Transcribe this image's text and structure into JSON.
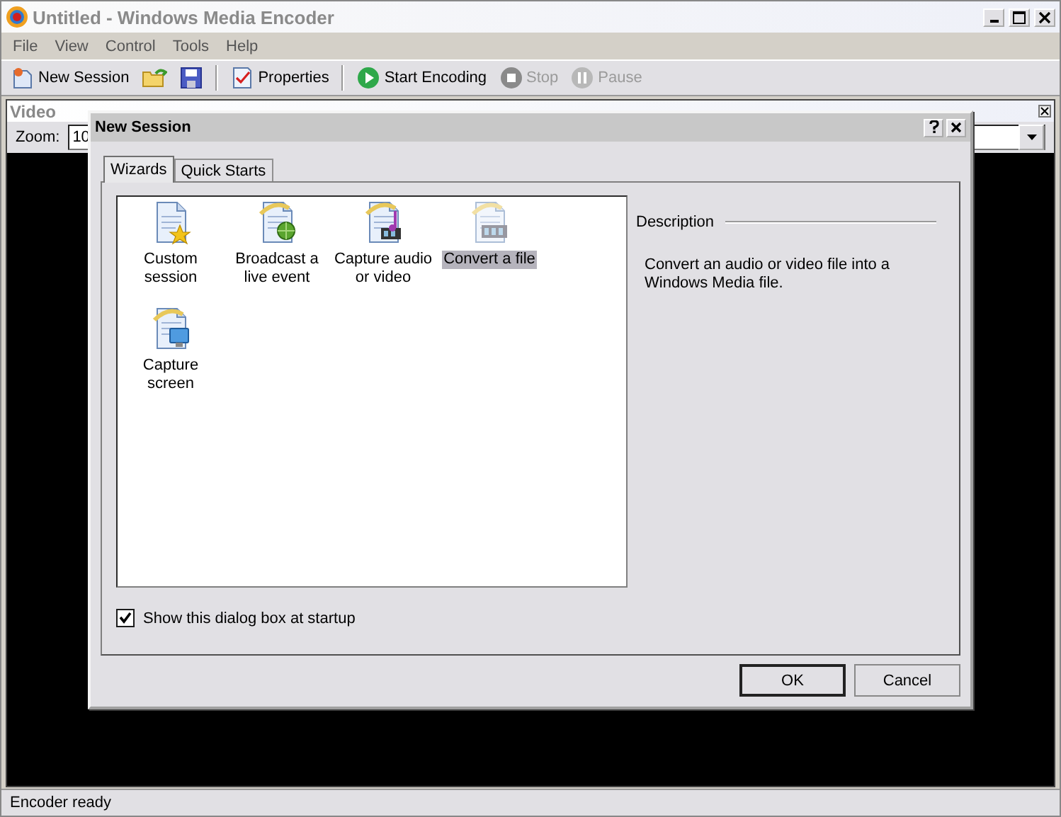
{
  "window": {
    "title": "Untitled - Windows Media Encoder"
  },
  "menu": [
    "File",
    "View",
    "Control",
    "Tools",
    "Help"
  ],
  "toolbar": [
    {
      "kind": "new",
      "label": "New Session",
      "disabled": false
    },
    {
      "kind": "open"
    },
    {
      "kind": "save"
    },
    {
      "kind": "separator"
    },
    {
      "kind": "properties",
      "label": "Properties",
      "disabled": false
    },
    {
      "kind": "separator"
    },
    {
      "kind": "start",
      "label": "Start Encoding",
      "disabled": false
    },
    {
      "kind": "stop",
      "label": "Stop",
      "disabled": true
    },
    {
      "kind": "pause",
      "label": "Pause",
      "disabled": true
    }
  ],
  "video_pane": {
    "title": "Video",
    "zoom_label": "Zoom:",
    "zoom_value": "10"
  },
  "dialog": {
    "title": "New Session",
    "tabs": [
      {
        "label": "Wizards",
        "selected": true
      },
      {
        "label": "Quick Starts",
        "selected": false
      }
    ],
    "wizards": [
      {
        "kind": "custom",
        "label": "Custom session",
        "selected": false
      },
      {
        "kind": "broadcast",
        "label": "Broadcast a live event",
        "selected": false
      },
      {
        "kind": "capture",
        "label": "Capture audio or video",
        "selected": false
      },
      {
        "kind": "convert",
        "label": "Convert a file",
        "selected": true
      },
      {
        "kind": "screen",
        "label": "Capture screen",
        "selected": false
      }
    ],
    "description": {
      "heading": "Description",
      "text": "Convert an audio or video file into a Windows Media file."
    },
    "startup_checkbox": {
      "label": "Show this dialog box at startup",
      "checked": true
    },
    "buttons": [
      {
        "label": "OK",
        "default": true
      },
      {
        "label": "Cancel",
        "default": false
      }
    ]
  },
  "status_bar": "Encoder ready"
}
